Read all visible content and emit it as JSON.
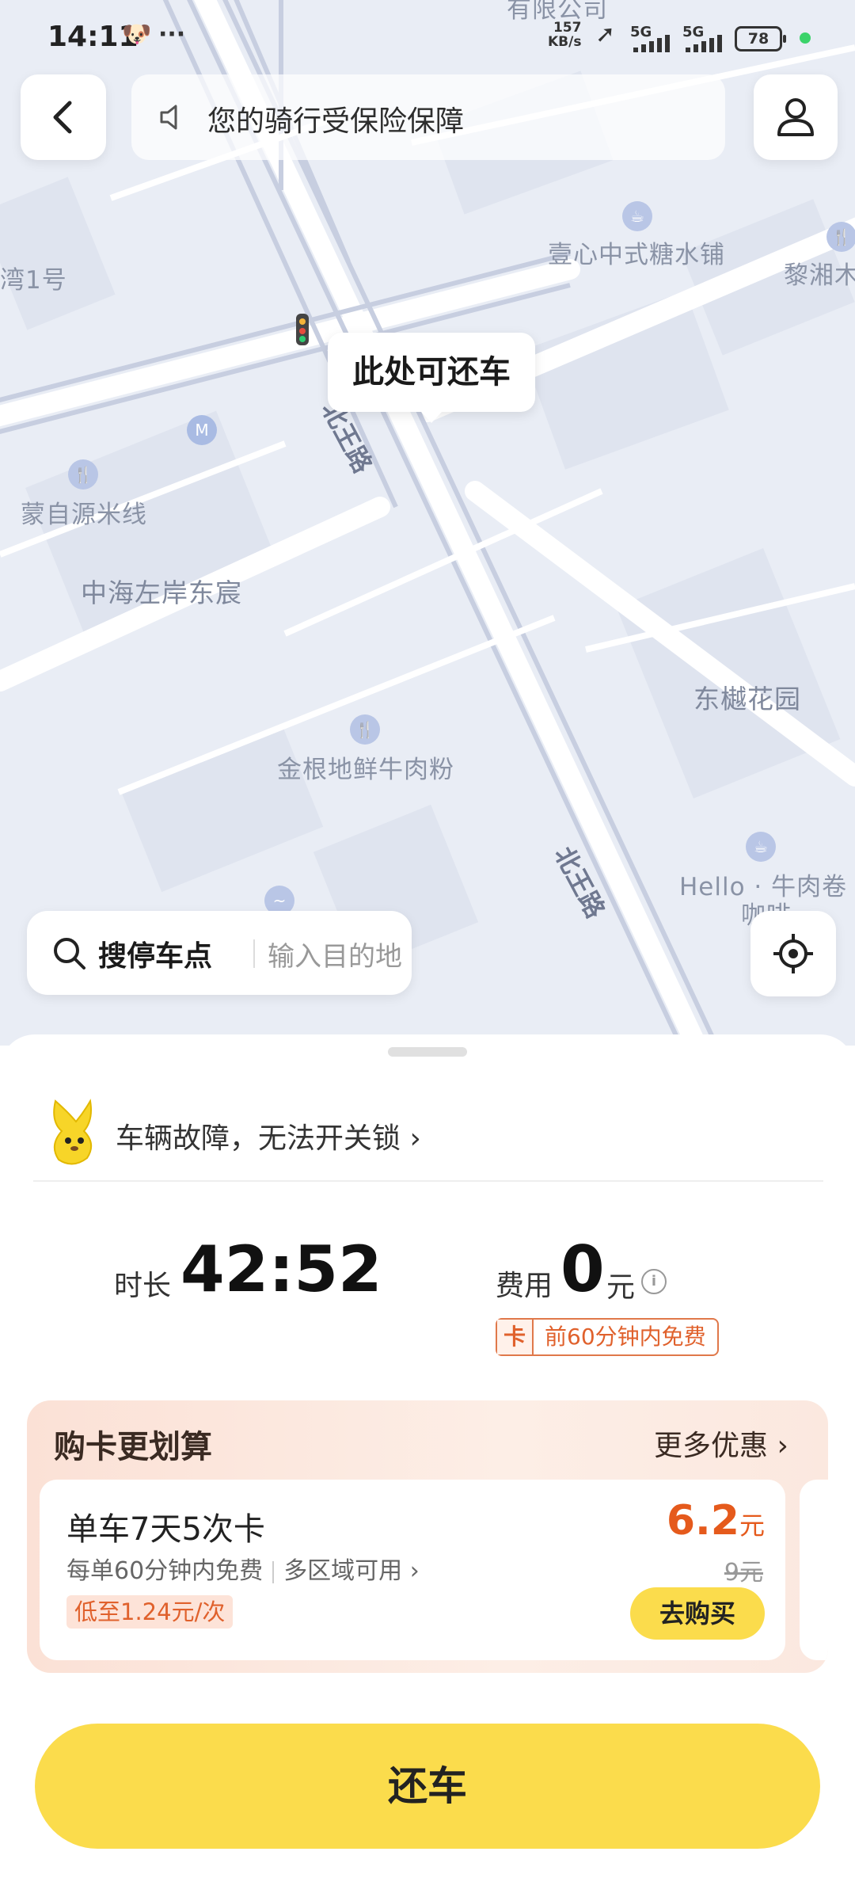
{
  "status_bar": {
    "time": "14:11",
    "net_speed_value": "157",
    "net_speed_unit": "KB/s",
    "signal_1": "5G",
    "signal_2": "5G",
    "battery": "78",
    "more_icon": "···"
  },
  "top": {
    "back_icon": "chevron-left-icon",
    "notice_icon": "speaker-icon",
    "notice_text": "您的骑行受保险保障",
    "profile_icon": "user-icon"
  },
  "map": {
    "bubble": "此处可还车",
    "top_partial": "有限公司",
    "labels": {
      "bay1": "湾1号",
      "sugar": "壹心中式糖水铺",
      "lixiang": "黎湘木",
      "mengziyuan": "蒙自源米线",
      "zhonghai": "中海左岸东宸",
      "dongchen": "东樾花园",
      "jingen": "金根地鲜牛肉粉",
      "hello_1": "Hello · 牛肉卷 ·",
      "hello_2": "咖啡",
      "road_north_1": "北王路",
      "road_north_2": "北王路"
    }
  },
  "search": {
    "label": "搜停车点",
    "placeholder": "输入目的地"
  },
  "sheet": {
    "fault_text": "车辆故障，无法开关锁 ›",
    "duration_label": "时长",
    "duration_value": "42:52",
    "fee_label": "费用",
    "fee_value": "0",
    "fee_unit": "元",
    "card_tag_icon": "卡",
    "card_tag_text": "前60分钟内免费"
  },
  "promo": {
    "title": "购卡更划算",
    "more": "更多优惠 ›",
    "card": {
      "name": "单车7天5次卡",
      "desc_1": "每单60分钟内免费",
      "desc_2": "多区域可用 ›",
      "tag": "低至1.24元/次",
      "price": "6.2",
      "price_unit": "元",
      "old_price": "9元",
      "buy": "去购买"
    }
  },
  "return_button": "还车",
  "colors": {
    "accent_yellow": "#fbdc4c",
    "price_orange": "#e55a1c",
    "map_bg": "#e9edf5"
  }
}
